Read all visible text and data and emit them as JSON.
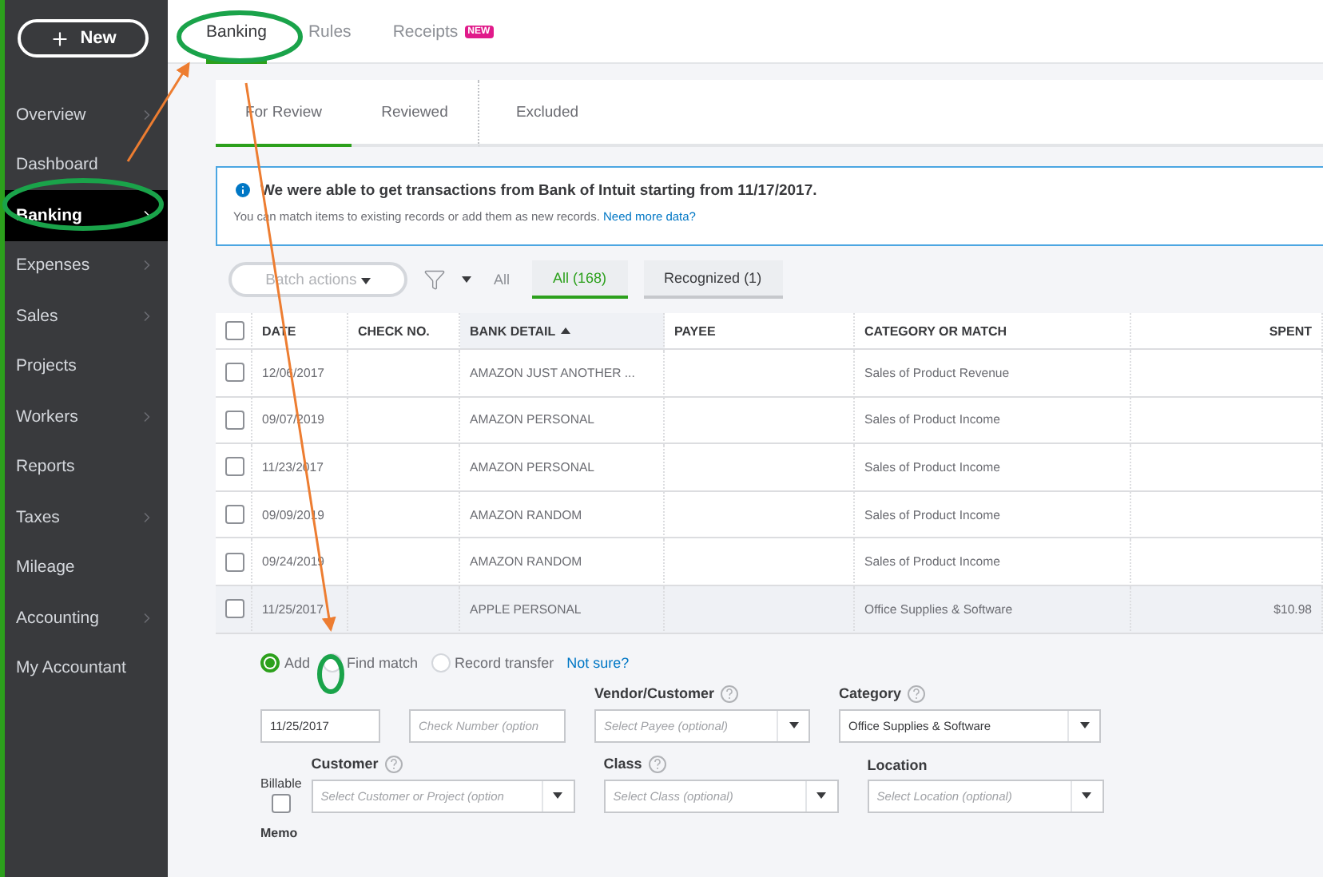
{
  "sidebar": {
    "new_button": "New",
    "items": [
      {
        "label": "Overview",
        "chevron": true,
        "selected": false
      },
      {
        "label": "Dashboard",
        "chevron": false,
        "selected": false
      },
      {
        "label": "Banking",
        "chevron": true,
        "selected": true
      },
      {
        "label": "Expenses",
        "chevron": true,
        "selected": false
      },
      {
        "label": "Sales",
        "chevron": true,
        "selected": false
      },
      {
        "label": "Projects",
        "chevron": false,
        "selected": false
      },
      {
        "label": "Workers",
        "chevron": true,
        "selected": false
      },
      {
        "label": "Reports",
        "chevron": false,
        "selected": false
      },
      {
        "label": "Taxes",
        "chevron": true,
        "selected": false
      },
      {
        "label": "Mileage",
        "chevron": false,
        "selected": false
      },
      {
        "label": "Accounting",
        "chevron": true,
        "selected": false
      },
      {
        "label": "My Accountant",
        "chevron": false,
        "selected": false
      }
    ]
  },
  "top_tabs": [
    {
      "label": "Banking",
      "selected": true
    },
    {
      "label": "Rules",
      "selected": false
    },
    {
      "label": "Receipts",
      "selected": false,
      "badge": "NEW"
    }
  ],
  "sub_tabs": [
    {
      "label": "For Review",
      "selected": true
    },
    {
      "label": "Reviewed",
      "selected": false
    },
    {
      "label": "Excluded",
      "selected": false
    }
  ],
  "info_banner": {
    "title": "We were able to get transactions from Bank of Intuit starting from 11/17/2017.",
    "text": "You can match items to existing records or add them as new records.",
    "link": "Need more data?"
  },
  "filters": {
    "batch_button": "Batch actions",
    "filter_label": "All",
    "chips": [
      {
        "label": "All (168)",
        "selected": true
      },
      {
        "label": "Recognized (1)",
        "selected": false
      }
    ]
  },
  "table": {
    "select_all_checked": false,
    "columns": [
      {
        "label": "DATE",
        "sorted": false
      },
      {
        "label": "CHECK NO.",
        "sorted": false
      },
      {
        "label": "BANK DETAIL",
        "sorted": true
      },
      {
        "label": "PAYEE",
        "sorted": false
      },
      {
        "label": "CATEGORY OR MATCH",
        "sorted": false
      },
      {
        "label": "SPENT",
        "sorted": false
      }
    ],
    "rows": [
      {
        "checked": false,
        "expanded": false,
        "date": "12/06/2017",
        "bank_detail": "AMAZON JUST ANOTHER ...",
        "category": "Sales of Product Revenue"
      },
      {
        "checked": false,
        "expanded": false,
        "date": "09/07/2019",
        "bank_detail": "AMAZON PERSONAL",
        "category": "Sales of Product Income"
      },
      {
        "checked": false,
        "expanded": false,
        "date": "11/23/2017",
        "bank_detail": "AMAZON PERSONAL",
        "category": "Sales of Product Income"
      },
      {
        "checked": false,
        "expanded": false,
        "date": "09/09/2019",
        "bank_detail": "AMAZON RANDOM",
        "category": "Sales of Product Income"
      },
      {
        "checked": false,
        "expanded": false,
        "date": "09/24/2019",
        "bank_detail": "AMAZON RANDOM",
        "category": "Sales of Product Income"
      },
      {
        "checked": false,
        "expanded": true,
        "date": "11/25/2017",
        "bank_detail": "APPLE PERSONAL",
        "category": "Office Supplies & Software",
        "spent": "$10.98"
      }
    ]
  },
  "detail_form": {
    "options": [
      {
        "label": "Add",
        "selected": true
      },
      {
        "label": "Find match",
        "selected": false
      },
      {
        "label": "Record transfer",
        "selected": false
      }
    ],
    "help_link": "Not sure?",
    "date": "11/25/2017",
    "check_placeholder": "Check Number (option",
    "vendor": {
      "label": "Vendor/Customer",
      "placeholder": "Select Payee (optional)"
    },
    "category": {
      "label": "Category",
      "value": "Office Supplies & Software"
    },
    "billable": {
      "label": "Billable",
      "checked": false
    },
    "customer": {
      "label": "Customer",
      "placeholder": "Select Customer or Project (option"
    },
    "class": {
      "label": "Class",
      "placeholder": "Select Class (optional)"
    },
    "location": {
      "label": "Location",
      "placeholder": "Select Location (optional)"
    },
    "memo_label": "Memo"
  }
}
